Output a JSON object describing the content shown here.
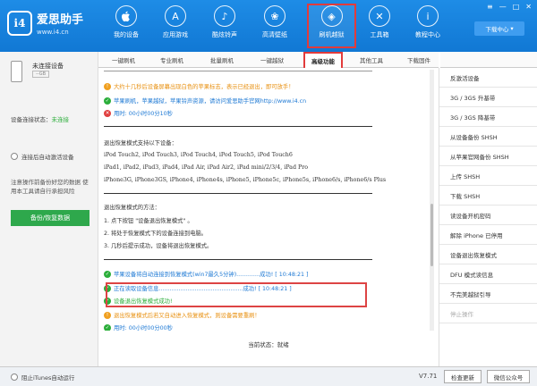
{
  "app": {
    "name": "爱思助手",
    "url": "www.i4.cn",
    "logo_text": "i4"
  },
  "nav": [
    {
      "label": "我的设备",
      "icon": "apple-icon",
      "glyph": ""
    },
    {
      "label": "应用游戏",
      "icon": "app-store-icon",
      "glyph": "A"
    },
    {
      "label": "酷炫铃声",
      "icon": "bell-icon",
      "glyph": "♪"
    },
    {
      "label": "高清壁纸",
      "icon": "flower-icon",
      "glyph": "❀"
    },
    {
      "label": "刷机越狱",
      "icon": "dropbox-icon",
      "glyph": "◈"
    },
    {
      "label": "工具箱",
      "icon": "tools-icon",
      "glyph": "✕"
    },
    {
      "label": "教程中心",
      "icon": "info-icon",
      "glyph": "i"
    }
  ],
  "window_controls": {
    "menu": "≡",
    "minimize": "—",
    "maximize": "□",
    "close": "✕"
  },
  "download_center": "下载中心",
  "left": {
    "device_name": "未连接设备",
    "device_capacity": "--GB",
    "connection_label": "设备连接状态：",
    "connection_status": "未连接",
    "auto_activate": "连接后自动激活设备",
    "note": "注意操作前备份好您的数据 使用本工具请自行承担风险",
    "backup_button": "备份/恢复数据"
  },
  "tabs": [
    "一键刷机",
    "专业刷机",
    "批量刷机",
    "一键越狱",
    "高级功能",
    "其他工具",
    "下载固件"
  ],
  "log_top": [
    {
      "type": "warn",
      "text": "大约十几秒后设备屏幕出现白色的苹果标志，表示已经退出，即可放手！"
    },
    {
      "type": "ok",
      "text": "苹果刷机，苹果越狱，苹果铃声资源，请访问爱思助手官网http://www.i4.cn"
    },
    {
      "type": "err",
      "text": "用时: 00小时00分10秒"
    }
  ],
  "info": {
    "supports_title": "退出恢复模式支持以下设备：",
    "devices_line1": "iPod Touch2, iPod Touch3, iPod Touch4, iPod Touch5, iPod Touch6",
    "devices_line2": "iPad1, iPad2, iPad3, iPad4, iPad Air, iPad Air2, iPad mini/2/3/4, iPad Pro",
    "devices_line3": "iPhone3G, iPhone3GS, iPhone4, iPhone4s, iPhone5, iPhone5c, iPhone5s, iPhone6/s, iPhone6/s Plus",
    "method_title": "退出恢复模式的方法：",
    "step1": "1. 点下按钮 \"设备退出恢复模式\" 。",
    "step2": "2. 将处于恢复模式下的设备连接到电脑。",
    "step3": "3. 几秒后提示成功，设备将退出恢复模式。"
  },
  "log_bottom": [
    {
      "type": "ok",
      "text": "苹果设备将自动连接到恢复模式(win7最久5分钟).............成功! [ 10:48:21 ]"
    },
    {
      "type": "ok",
      "text": "正在读取设备信息...............................................成功! [ 10:48:21 ]"
    },
    {
      "type": "ok",
      "text": "设备退出恢复模式成功!"
    },
    {
      "type": "warn",
      "text": "退出恢复模式后若又自动进入恢复模式，则设备需要重刷！"
    },
    {
      "type": "ok",
      "text": "用时: 00小时00分00秒"
    }
  ],
  "status": {
    "label": "当前状态：",
    "value": "就绪"
  },
  "right_menu": [
    {
      "label": "反激活设备",
      "enabled": true
    },
    {
      "label": "3G / 3GS 升基带",
      "enabled": true
    },
    {
      "label": "3G / 3GS 降基带",
      "enabled": true
    },
    {
      "label": "从设备备份 SHSH",
      "enabled": true
    },
    {
      "label": "从苹果官网备份 SHSH",
      "enabled": true
    },
    {
      "label": "上传 SHSH",
      "enabled": true
    },
    {
      "label": "下载 SHSH",
      "enabled": true
    },
    {
      "label": "读设备开机密码",
      "enabled": true
    },
    {
      "label": "解除 iPhone 已停用",
      "enabled": true
    },
    {
      "label": "设备退出恢复模式",
      "enabled": true
    },
    {
      "label": "DFU 模式读信息",
      "enabled": true
    },
    {
      "label": "不完美越狱引导",
      "enabled": true
    },
    {
      "label": "停止操作",
      "enabled": false
    }
  ],
  "footer": {
    "itunes": "阻止iTunes自动运行",
    "version": "V7.71",
    "check_update": "检查更新",
    "wechat": "微信公众号"
  },
  "colors": {
    "header": "#1b87e3",
    "accent_red": "#e23b3b",
    "green": "#2bae3a",
    "orange": "#f0a020"
  }
}
